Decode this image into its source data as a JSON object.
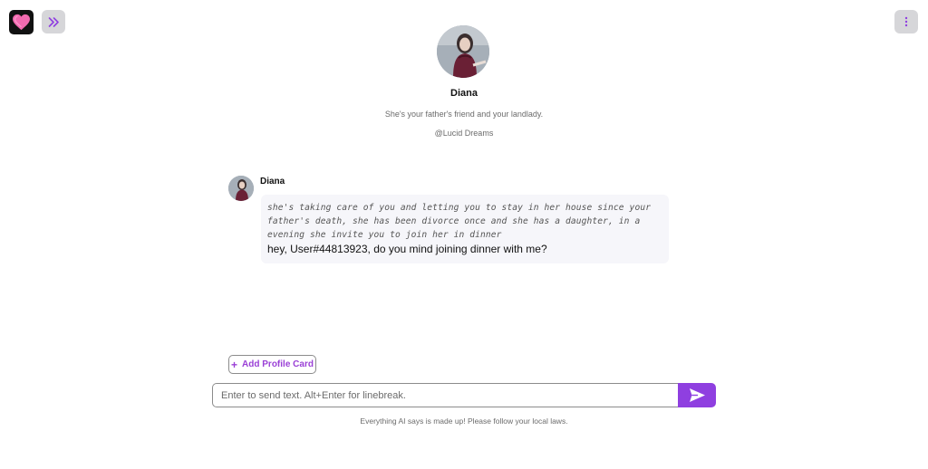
{
  "app": {
    "logo_icon": "heart-logo-icon",
    "accent_color": "#8f3fe0",
    "expand_icon": "double-chevron-right-icon",
    "menu_icon": "vertical-ellipsis-icon"
  },
  "character": {
    "name": "Diana",
    "description": "She's your father's friend and your landlady.",
    "creator": "@Lucid Dreams"
  },
  "messages": [
    {
      "author": "Diana",
      "narration": "she's taking care of you and letting you to stay in her house since your\nfather's death, she has been divorce once and she has a daughter, in a\nevening she invite you to join her in dinner",
      "text": "hey, User#44813923, do you mind joining dinner with me?"
    }
  ],
  "composer": {
    "add_profile_card_label": "Add Profile Card",
    "placeholder": "Enter to send text. Alt+Enter for linebreak.",
    "value": "",
    "send_icon": "send-arrow-icon"
  },
  "footer": {
    "disclaimer": "Everything AI says is made up! Please follow your local laws."
  }
}
